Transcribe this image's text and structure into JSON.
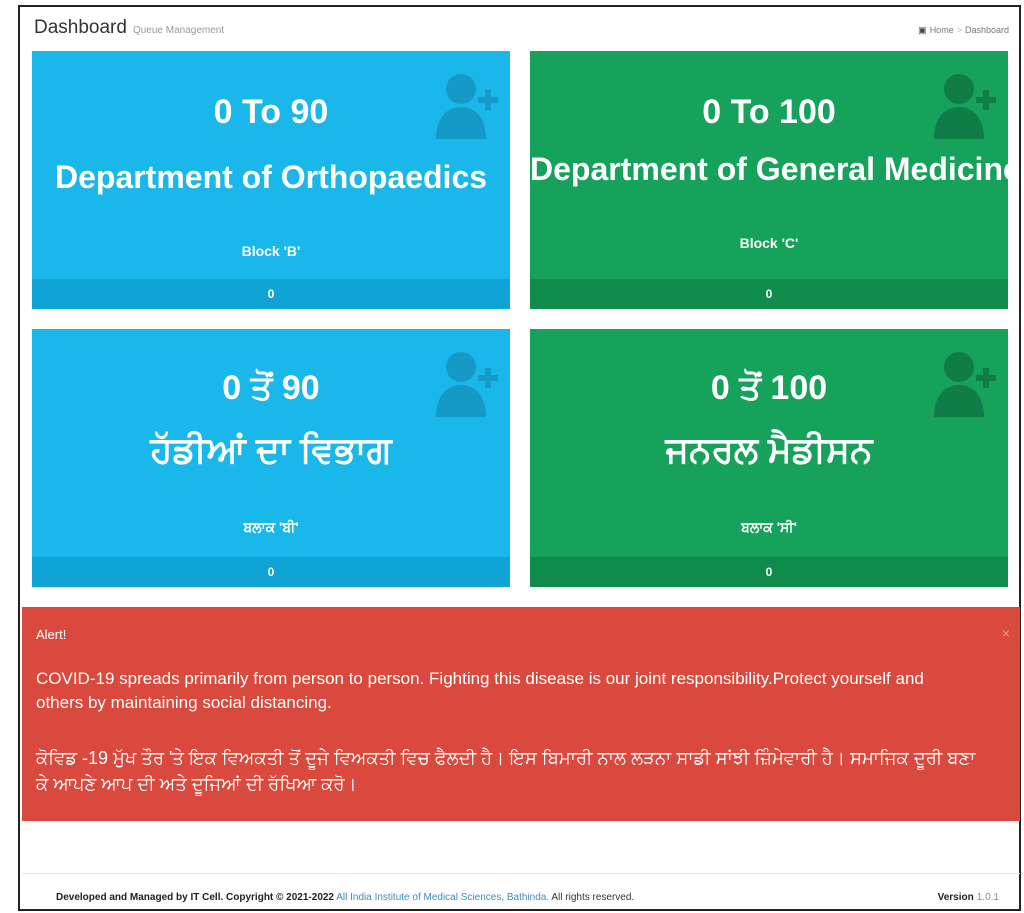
{
  "header": {
    "title": "Dashboard",
    "subtitle": "Queue Management",
    "breadcrumb": {
      "home": "Home",
      "current": "Dashboard"
    }
  },
  "tiles": [
    {
      "range": "0 To 90",
      "department": "Department of Orthopaedics",
      "block": "Block 'B'",
      "count": "0",
      "icon": "user-plus-icon",
      "color": "#1ab7ea"
    },
    {
      "range": "0 To 100",
      "department": "Department of General Medicine",
      "block": "Block 'C'",
      "count": "0",
      "icon": "user-plus-icon",
      "color": "#16a25a"
    },
    {
      "range": "0 ਤੋਂ 90",
      "department": "ਹੱਡੀਆਂ ਦਾ ਵਿਭਾਗ",
      "block": "ਬਲਾਕ 'ਬੀ'",
      "count": "0",
      "icon": "user-plus-icon",
      "color": "#1ab7ea"
    },
    {
      "range": "0 ਤੋਂ 100",
      "department": "ਜਨਰਲ ਮੈਡੀਸਨ",
      "block": "ਬਲਾਕ 'ਸੀ'",
      "count": "0",
      "icon": "user-plus-icon",
      "color": "#16a25a"
    }
  ],
  "alert": {
    "title": "Alert!",
    "close": "×",
    "message_en": "COVID-19 spreads primarily from person to person. Fighting this disease is our joint responsibility.Protect yourself and others by maintaining social distancing.",
    "message_pa": "ਕੋਵਿਡ -19 ਮੁੱਖ ਤੌਰ 'ਤੇ ਇਕ ਵਿਅਕਤੀ ਤੋਂ ਦੂਜੇ ਵਿਅਕਤੀ ਵਿਚ ਫੈਲਦੀ ਹੈ। ਇਸ ਬਿਮਾਰੀ ਨਾਲ ਲੜਨਾ ਸਾਡੀ ਸਾਂਝੀ ਜ਼ਿੰਮੇਵਾਰੀ ਹੈ। ਸਮਾਜਿਕ ਦੂਰੀ ਬਣਾ ਕੇ ਆਪਣੇ ਆਪ ਦੀ ਅਤੇ ਦੂਜਿਆਂ ਦੀ ਰੱਖਿਆ ਕਰੋ।",
    "color": "#d9493d"
  },
  "footer": {
    "developed": "Developed and Managed by IT Cell. Copyright © 2021-2022",
    "link": "All India Institute of Medical Sciences, Bathinda.",
    "rights": "All rights reserved.",
    "version_label": "Version",
    "version": "1.0.1"
  }
}
